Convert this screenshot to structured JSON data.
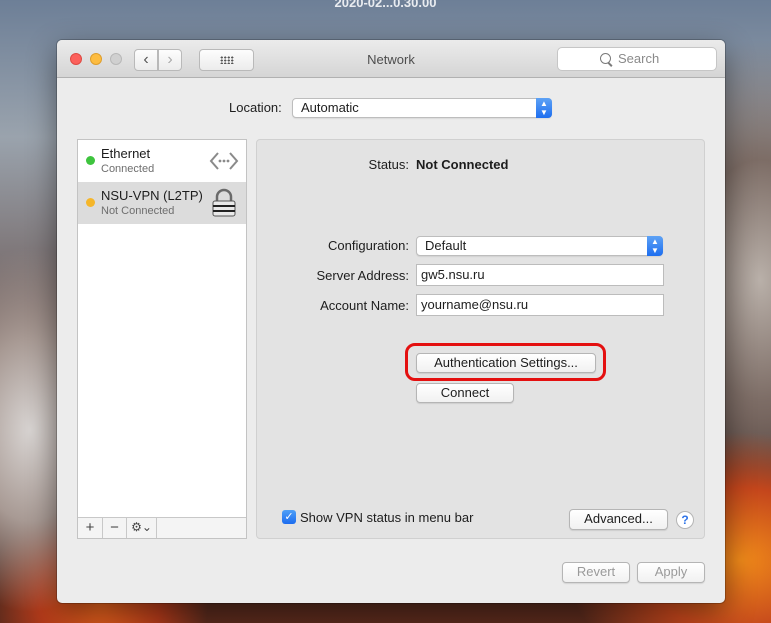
{
  "desktop": {
    "clock": "2020-02...0.30.00"
  },
  "window": {
    "title": "Network",
    "search_placeholder": "Search"
  },
  "location": {
    "label": "Location:",
    "value": "Automatic"
  },
  "services": [
    {
      "name": "Ethernet",
      "status": "Connected",
      "dot_color": "#3ec43e",
      "icon": "ethernet-arrows-icon"
    },
    {
      "name": "NSU-VPN (L2TP)",
      "status": "Not Connected",
      "dot_color": "#f5b62a",
      "icon": "vpn-lock-icon"
    }
  ],
  "sidebar_toolbar": {
    "add": "+",
    "remove": "−",
    "action": "⚙⌄"
  },
  "detail": {
    "status_label": "Status:",
    "status_value": "Not Connected",
    "configuration_label": "Configuration:",
    "configuration_value": "Default",
    "server_label": "Server Address:",
    "server_value": "gw5.nsu.ru",
    "account_label": "Account Name:",
    "account_value": "yourname@nsu.ru",
    "auth_button": "Authentication Settings...",
    "connect_button": "Connect",
    "show_vpn_label": "Show VPN status in menu bar",
    "show_vpn_checked": true,
    "advanced_button": "Advanced...",
    "help": "?"
  },
  "footer": {
    "revert": "Revert",
    "apply": "Apply"
  },
  "colors": {
    "highlight": "#e41010",
    "accent": "#1d6ef0"
  }
}
